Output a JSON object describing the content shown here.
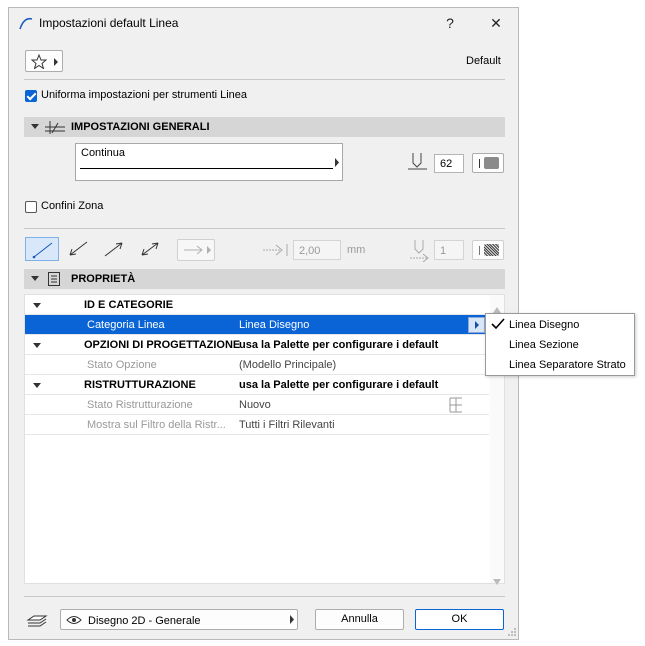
{
  "window": {
    "title": "Impostazioni default Linea",
    "help_glyph": "?",
    "close_glyph": "✕"
  },
  "header": {
    "default_label": "Default"
  },
  "uniform": {
    "label": "Uniforma impostazioni per strumenti Linea",
    "checked": true
  },
  "general": {
    "title": "IMPOSTAZIONI GENERALI",
    "line_type": "Continua",
    "pen_number": "62"
  },
  "zone": {
    "label": "Confini Zona",
    "checked": false
  },
  "arrow": {
    "size_value": "2,00",
    "size_unit": "mm",
    "pen_value": "1"
  },
  "properties": {
    "title": "PROPRIETÀ",
    "rows": [
      {
        "type": "group",
        "label": "ID E CATEGORIE",
        "value": ""
      },
      {
        "type": "selected",
        "label": "Categoria Linea",
        "value": "Linea Disegno"
      },
      {
        "type": "group",
        "label": "OPZIONI DI PROGETTAZIONE",
        "value": "usa la Palette per configurare i default"
      },
      {
        "type": "dim",
        "label": "Stato Opzione",
        "value": "(Modello Principale)"
      },
      {
        "type": "group",
        "label": "RISTRUTTURAZIONE",
        "value": "usa la Palette per configurare i default"
      },
      {
        "type": "dim",
        "label": "Stato Ristrutturazione",
        "value": "Nuovo"
      },
      {
        "type": "dim",
        "label": "Mostra sul Filtro della Ristr...",
        "value": "Tutti i Filtri Rilevanti"
      }
    ]
  },
  "dropdown": {
    "options": [
      "Linea Disegno",
      "Linea Sezione",
      "Linea Separatore Strato"
    ],
    "selected_index": 0
  },
  "footer": {
    "layer": "Disegno 2D - Generale",
    "cancel_label": "Annulla",
    "ok_label": "OK"
  }
}
